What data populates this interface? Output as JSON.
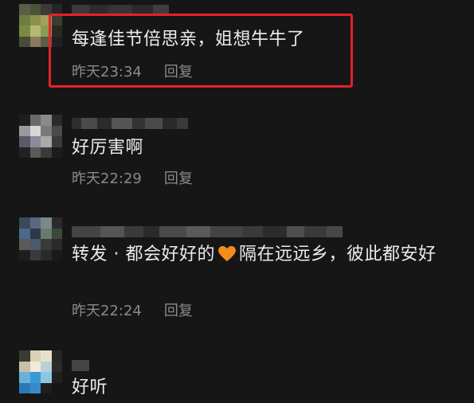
{
  "comments": [
    {
      "text": "每逢佳节倍思亲，姐想牛牛了",
      "time": "昨天23:34",
      "reply_label": "回复",
      "highlighted": true
    },
    {
      "text": "好厉害啊",
      "time": "昨天22:29",
      "reply_label": "回复",
      "highlighted": false
    },
    {
      "text_before_emoji": "转发 · 都会好好的",
      "emoji": "orange-heart",
      "text_after_emoji": "隔在远远乡，彼此都安好",
      "time": "昨天22:24",
      "reply_label": "回复",
      "highlighted": false
    },
    {
      "text": "好听",
      "highlighted": false
    }
  ],
  "colors": {
    "background": "#161616",
    "highlight_border": "#e3222a",
    "meta_text": "#8a8a8a",
    "heart": "#f28c1b"
  }
}
